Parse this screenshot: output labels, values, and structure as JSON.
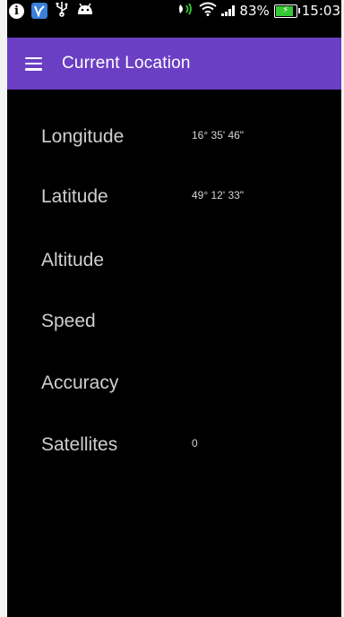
{
  "status_bar": {
    "info_glyph": "i",
    "battery_percent": "83%",
    "time": "15:03",
    "icons": [
      "info-icon",
      "app-notification-icon",
      "usb-icon",
      "android-debug-icon",
      "nfc-icon",
      "wifi-icon",
      "cell-signal-icon",
      "battery-charging-icon"
    ],
    "battery_fill_fraction": 0.83,
    "battery_color": "#35c935"
  },
  "app_bar": {
    "title": "Current Location",
    "color": "#6a3fc4",
    "menu_icon": "hamburger-menu-icon"
  },
  "rows": [
    {
      "label": "Longitude",
      "value": "16° 35' 46\""
    },
    {
      "label": "Latitude",
      "value": "49° 12' 33\""
    },
    {
      "label": "Altitude",
      "value": ""
    },
    {
      "label": "Speed",
      "value": ""
    },
    {
      "label": "Accuracy",
      "value": ""
    },
    {
      "label": "Satellites",
      "value": "0"
    }
  ]
}
